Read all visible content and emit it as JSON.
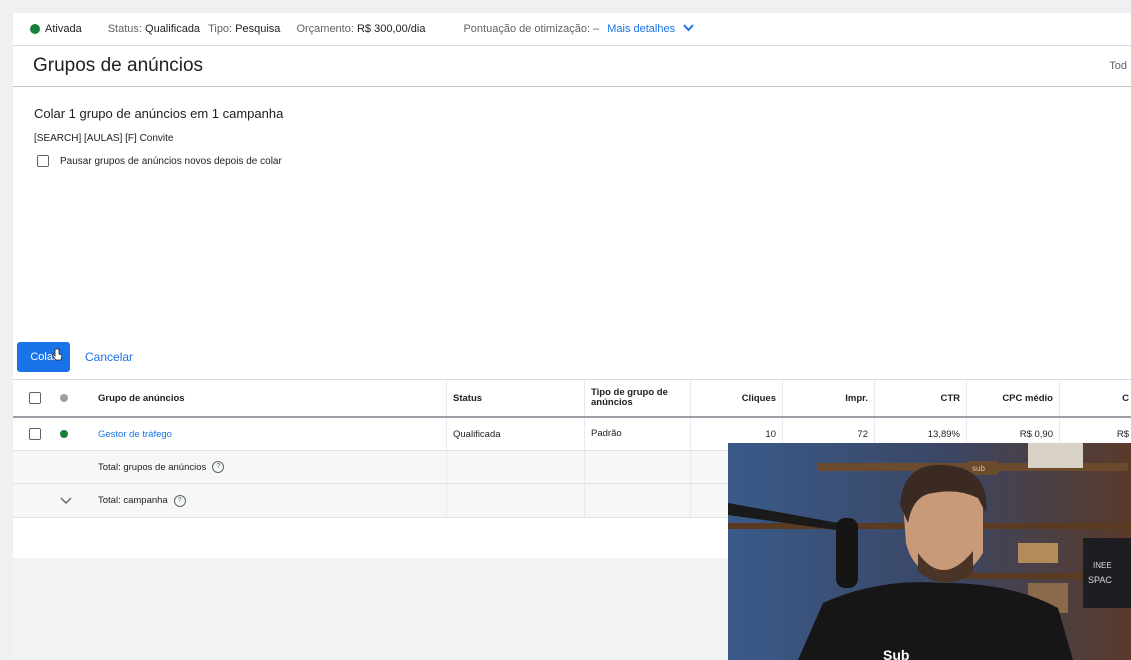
{
  "statusbar": {
    "status_label": "Ativada",
    "status_prefix": "Status:",
    "status_value": "Qualificada",
    "type_prefix": "Tipo:",
    "type_value": "Pesquisa",
    "budget_prefix": "Orçamento:",
    "budget_value": "R$ 300,00/dia",
    "optimization": "Pontuação de otimização: –",
    "more_details": "Mais detalhes"
  },
  "header": {
    "title": "Grupos de anúncios",
    "right_text": "Tod"
  },
  "paste_panel": {
    "title": "Colar 1 grupo de anúncios em 1 campanha",
    "campaign": "[SEARCH] [AULAS] [F] Convite",
    "pause_label": "Pausar grupos de anúncios novos depois de colar",
    "paste_button": "Colar",
    "cancel_button": "Cancelar"
  },
  "table": {
    "headers": {
      "group": "Grupo de anúncios",
      "status": "Status",
      "type": "Tipo de grupo de anúncios",
      "clicks": "Cliques",
      "impr": "Impr.",
      "ctr": "CTR",
      "cpc": "CPC médio",
      "extra": "C"
    },
    "rows": [
      {
        "name": "Gestor de tráfego",
        "status": "Qualificada",
        "type": "Padrão",
        "clicks": "10",
        "impr": "72",
        "ctr": "13,89%",
        "cpc": "R$ 0,90",
        "extra": "R$"
      }
    ],
    "total_groups": "Total: grupos de anúncios",
    "total_campaign": "Total: campanha"
  },
  "colors": {
    "accent": "#1a73e8",
    "enabled_green": "#188038"
  }
}
